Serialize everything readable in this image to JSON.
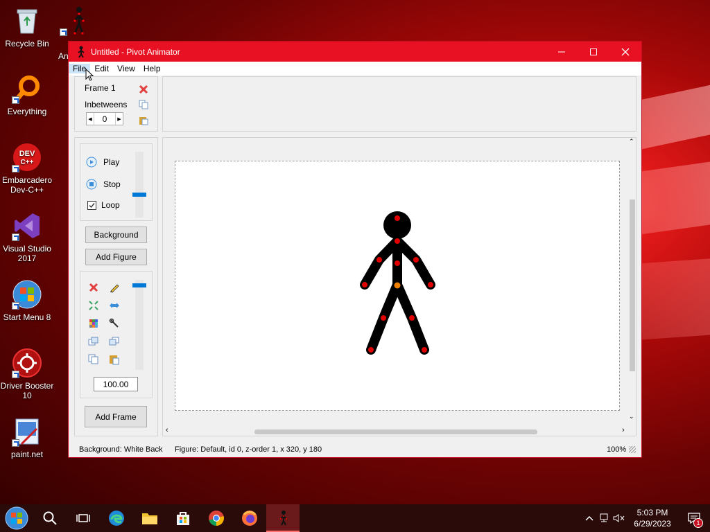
{
  "desktop": {
    "icons": [
      {
        "label": "Recycle Bin",
        "name": "recycle-bin"
      },
      {
        "label": "Everything",
        "name": "everything"
      },
      {
        "label": "Embarcadero Dev-C++",
        "name": "devcpp"
      },
      {
        "label": "Visual Studio 2017",
        "name": "visual-studio"
      },
      {
        "label": "Start Menu 8",
        "name": "start-menu-8"
      },
      {
        "label": "Driver Booster 10",
        "name": "driver-booster"
      },
      {
        "label": "paint.net",
        "name": "paint-net"
      },
      {
        "label": "An",
        "name": "pivot-animator-shortcut"
      }
    ]
  },
  "window": {
    "title": "Untitled - Pivot Animator",
    "menu": [
      "File",
      "Edit",
      "View",
      "Help"
    ]
  },
  "frame_panel": {
    "frame_label": "Frame 1",
    "inbetweens_label": "Inbetweens",
    "inbetweens_value": "0"
  },
  "playback": {
    "play_label": "Play",
    "stop_label": "Stop",
    "loop_label": "Loop",
    "loop_checked": true
  },
  "buttons": {
    "background": "Background",
    "add_figure": "Add Figure",
    "add_frame": "Add Frame"
  },
  "figure_tools": {
    "scale_value": "100.00"
  },
  "status": {
    "background": "Background: White Back",
    "figure": "Figure: Default,  id 0,  z-order 1,  x 320, y 180",
    "zoom": "100%"
  },
  "taskbar": {
    "time": "5:03 PM",
    "date": "6/29/2023",
    "notification_count": "1"
  },
  "colors": {
    "titlebar": "#e81123",
    "joint": "#e00000",
    "center_joint": "#f08000"
  }
}
